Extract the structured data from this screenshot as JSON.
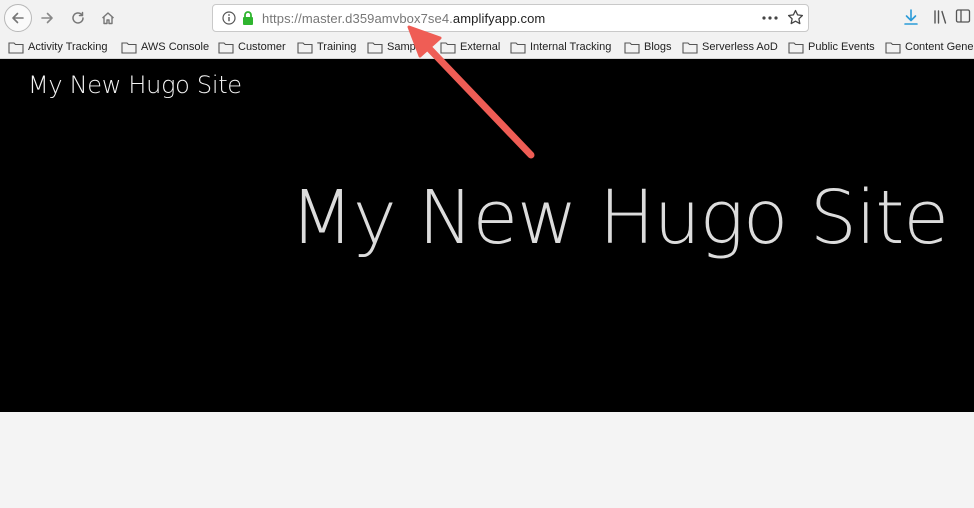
{
  "browser": {
    "url": {
      "scheme": "https://",
      "subdomain": "master.d359amvbox7se4.",
      "domain": "amplifyapp.com"
    },
    "bookmarks": [
      "Activity Tracking",
      "AWS Console",
      "Customer",
      "Training",
      "Samples",
      "External",
      "Internal Tracking",
      "Blogs",
      "Serverless AoD",
      "Public Events",
      "Content Gene"
    ],
    "icons": [
      "back-icon",
      "forward-icon",
      "reload-icon",
      "home-icon",
      "info-icon",
      "lock-icon",
      "more-icon",
      "star-icon",
      "download-icon",
      "library-icon",
      "sidebar-icon",
      "folder-icon"
    ]
  },
  "page": {
    "brand": "My New Hugo Site",
    "hero_title": "My New Hugo Site"
  },
  "annotation": {
    "type": "arrow",
    "color": "#ef5d55"
  },
  "colors": {
    "hero_bg": "#000000",
    "toolbar_bg": "#f2f2f2",
    "lock_green": "#2fb52f",
    "download_blue": "#2a9bd8"
  }
}
